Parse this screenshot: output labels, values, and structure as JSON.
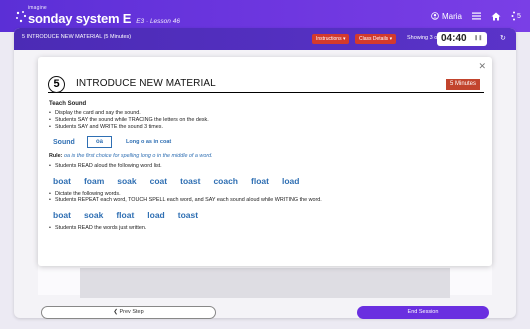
{
  "header": {
    "brand_small": "imagine",
    "brand_name": "sonday system E",
    "lesson": "E3 · Lesson 46",
    "user": "Maria",
    "menu_icon": "hamburger-icon",
    "home_icon": "home-icon",
    "level": "5"
  },
  "subbar": {
    "title": "5 INTRODUCE NEW MATERIAL (5 Minutes)",
    "instructions_label": "Instructions ▾",
    "class_details_label": "Class Details ▾",
    "showing": "Showing 3 of 5",
    "timer": "04:40"
  },
  "modal": {
    "step_number": "5",
    "title": "INTRODUCE NEW MATERIAL",
    "minutes": "5 Minutes",
    "section": "Teach Sound",
    "bullets_1": [
      "Display the card and say the sound.",
      "Students SAY the sound while TRACING the letters on the desk.",
      "Students SAY and WRITE the sound 3 times."
    ],
    "sound_label": "Sound",
    "sound": "oa",
    "sound_desc": "Long o as in coat",
    "rule_label": "Rule:",
    "rule_text": "oa is the first choice for spelling long o in the middle of a word.",
    "bullets_2": [
      "Students READ aloud the following word list."
    ],
    "words_1": [
      "boat",
      "foam",
      "soak",
      "coat",
      "toast",
      "coach",
      "float",
      "load"
    ],
    "bullets_3": [
      "Dictate the following words.",
      "Students REPEAT each word, TOUCH SPELL each word, and SAY each sound aloud while WRITING the word."
    ],
    "words_2": [
      "boat",
      "soak",
      "float",
      "load",
      "toast"
    ],
    "bullets_4": [
      "Students READ the words just written."
    ]
  },
  "footer": {
    "prev_label": "❮ Prev Step",
    "end_label": "End Session"
  },
  "colors": {
    "header": "#5b2fd6",
    "accent_blue": "#2f6fb3",
    "badge_red": "#c2442d",
    "end_button": "#6a2fe0"
  }
}
